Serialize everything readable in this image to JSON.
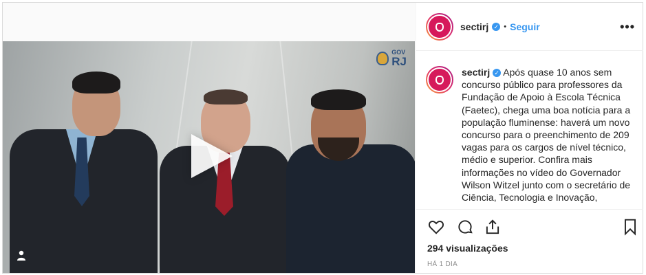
{
  "post": {
    "account": {
      "username": "sectirj",
      "verified_badge": "✓",
      "follow_label": "Seguir",
      "separator": "•"
    },
    "media": {
      "type": "video",
      "overlay_logo": {
        "small": "GOV",
        "big": "RJ"
      },
      "controls": [
        "play-icon",
        "tag-people-icon"
      ]
    },
    "caption": {
      "username": "sectirj",
      "text": "Após quase 10 anos sem concurso público para professores da Fundação de Apoio à Escola Técnica (Faetec), chega uma boa notícia para a população fluminense: haverá um novo concurso para o preenchimento de 209 vagas para os cargos de nível técnico, médio e superior. Confira mais informações no vídeo do Governador Wilson Witzel junto com o secretário de Ciência, Tecnologia e Inovação,"
    },
    "actions": {
      "icons": [
        "heart-icon",
        "comment-icon",
        "share-icon",
        "bookmark-icon"
      ]
    },
    "views": "294 visualizações",
    "timestamp": "HÁ 1 DIA"
  },
  "colors": {
    "link_blue": "#3897f0",
    "brand_pink": "#d6195b",
    "border": "#dbdbdb"
  }
}
